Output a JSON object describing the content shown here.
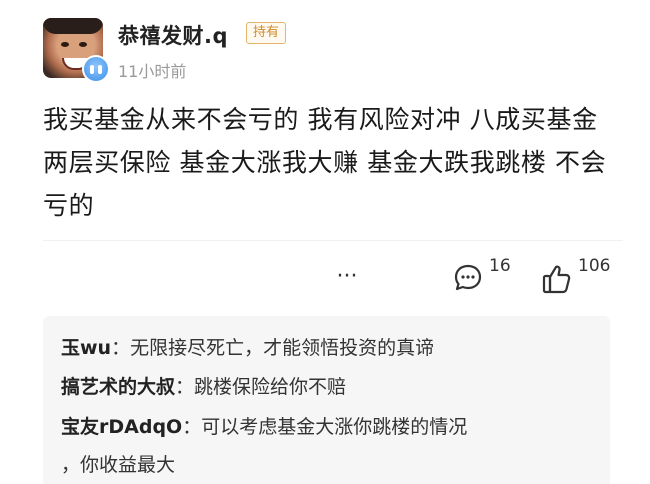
{
  "post": {
    "username": "恭禧发财.q",
    "tag": "持有",
    "time": "11小时前",
    "content": "我买基金从来不会亏的 我有风险对冲 八成买基金 两层买保险 基金大涨我大赚 基金大跌我跳楼 不会亏的",
    "actions": {
      "more": "···",
      "comment_count": "16",
      "like_count": "106"
    }
  },
  "replies": [
    {
      "author": "玉wu",
      "separator": "：",
      "text": "无限接尽死亡，才能领悟投资的真谛"
    },
    {
      "author": "搞艺术的大叔",
      "separator": "：",
      "text": "跳楼保险给你不赔"
    },
    {
      "author": "宝友rDAdqO",
      "separator": "：",
      "text": "可以考虑基金大涨你跳楼的情况",
      "continuation": "，你收益最大"
    }
  ],
  "icons": {
    "avatar": "user-avatar",
    "badge": "crying-face-icon",
    "more": "more-dots-icon",
    "comment": "comment-bubble-icon",
    "like": "thumbs-up-icon"
  },
  "colors": {
    "tag_border": "#e7b36a",
    "tag_text": "#d08a2a",
    "reply_bg": "#f6f6f6"
  }
}
